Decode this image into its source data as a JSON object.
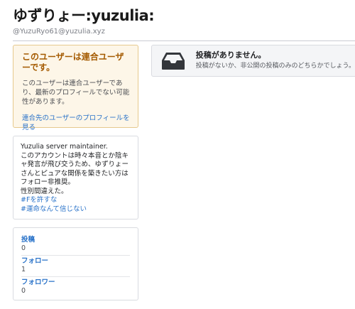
{
  "profile": {
    "display_name": "ゆずりょー:yuzulia:",
    "acct": "@YuzuRyo61@yuzulia.xyz"
  },
  "federated_notice": {
    "title": "このユーザーは連合ユーザーです。",
    "body": "このユーザーは連合ユーザーであり、最新のプロフィールでない可能性があります。",
    "link": "連合先のユーザーのプロフィールを見る"
  },
  "bio": {
    "lines": [
      "Yuzulia server maintainer.",
      "このアカウントは時々本音とか陰キャ発言が飛び交うため、ゆずりょーさんとピュアな関係を築きたい方はフォロー非推奨。",
      "性別間違えた。"
    ],
    "tags": [
      "#Fを許すな",
      "#運命なんて信じない"
    ]
  },
  "stats": [
    {
      "label": "投稿",
      "value": "0"
    },
    {
      "label": "フォロー",
      "value": "1"
    },
    {
      "label": "フォロワー",
      "value": "0"
    }
  ],
  "empty_state": {
    "icon": "inbox-icon",
    "title": "投稿がありません。",
    "subtitle": "投稿がないか、非公開の投稿のみのどちらかでしょう。"
  },
  "colors": {
    "accent": "#2a73c9",
    "notice_bg": "#fdf6e8",
    "notice_border": "#e6c98d",
    "notice_title": "#a45a00"
  }
}
